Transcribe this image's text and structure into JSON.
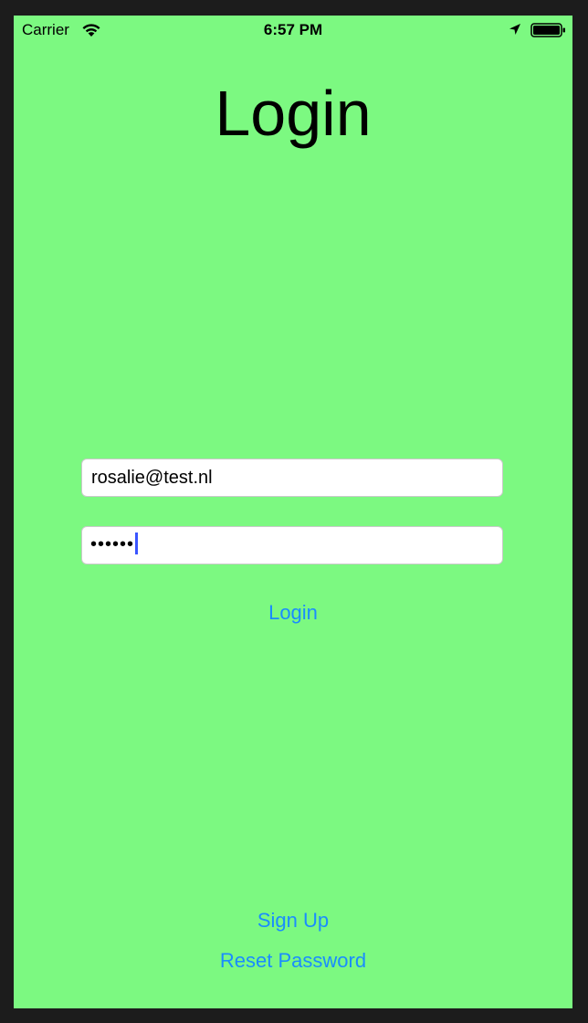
{
  "status_bar": {
    "carrier": "Carrier",
    "time": "6:57 PM",
    "icons": [
      "wifi-icon",
      "location-icon",
      "battery-icon"
    ]
  },
  "screen": {
    "title": "Login",
    "background_color": "#7cf981",
    "link_color": "#1a8cff"
  },
  "form": {
    "email_value": "rosalie@test.nl",
    "password_masked": "••••••",
    "login_label": "Login"
  },
  "footer": {
    "signup_label": "Sign Up",
    "reset_label": "Reset Password"
  }
}
